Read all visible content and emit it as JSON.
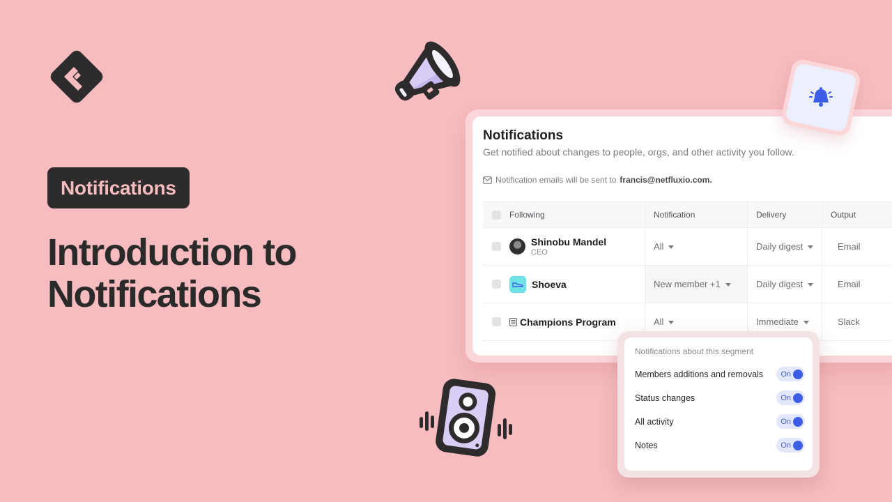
{
  "hero": {
    "badge": "Notifications",
    "title_line1": "Introduction to",
    "title_line2": "Notifications"
  },
  "panel": {
    "title": "Notifications",
    "subtitle": "Get notified about changes to people, orgs, and other activity you follow.",
    "email_note_prefix": "Notification emails will be sent to",
    "email": "francis@netfluxio.com."
  },
  "table": {
    "headers": [
      "Following",
      "Notification",
      "Delivery",
      "Output"
    ],
    "rows": [
      {
        "name": "Shinobu Mandel",
        "subtitle": "CEO",
        "type": "person",
        "notification": "All",
        "delivery": "Daily digest",
        "output": "Email"
      },
      {
        "name": "Shoeva",
        "subtitle": "",
        "type": "org",
        "notification": "New member +1",
        "delivery": "Daily digest",
        "output": "Email"
      },
      {
        "name": "Champions Program",
        "subtitle": "",
        "type": "segment",
        "notification": "All",
        "delivery": "Immediate",
        "output": "Slack"
      }
    ]
  },
  "popover": {
    "title": "Notifications about this segment",
    "items": [
      {
        "label": "Members additions and removals",
        "state": "On"
      },
      {
        "label": "Status changes",
        "state": "On"
      },
      {
        "label": "All activity",
        "state": "On"
      },
      {
        "label": "Notes",
        "state": "On"
      }
    ]
  },
  "colors": {
    "background": "#f7bcbf",
    "dark": "#2d2b2c",
    "accent_blue": "#3d5de6",
    "toggle_bg": "#e3e7fb",
    "illustration_purple": "#d9cdf5"
  }
}
